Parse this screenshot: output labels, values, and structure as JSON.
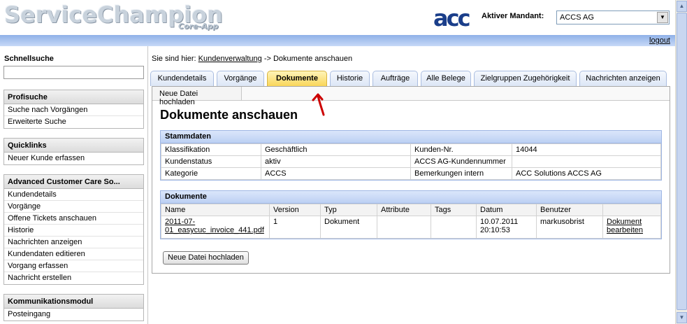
{
  "header": {
    "logo_main": "ServiceChampion",
    "logo_sub": "Core-App",
    "company_logo": "acc",
    "mandant_label": "Aktiver Mandant:",
    "mandant_value": "ACCS AG",
    "logout": "logout"
  },
  "sidebar": {
    "quick_search_title": "Schnellsuche",
    "sections": [
      {
        "title": "Profisuche",
        "items": [
          "Suche nach Vorgängen",
          "Erweiterte Suche"
        ]
      },
      {
        "title": "Quicklinks",
        "items": [
          "Neuer Kunde erfassen"
        ]
      },
      {
        "title": "Advanced Customer Care So...",
        "items": [
          "Kundendetails",
          "Vorgänge",
          "Offene Tickets anschauen",
          "Historie",
          "Nachrichten anzeigen",
          "Kundendaten editieren",
          "Vorgang erfassen",
          "Nachricht erstellen"
        ]
      },
      {
        "title": "Kommunikationsmodul",
        "items": [
          "Posteingang"
        ]
      }
    ]
  },
  "breadcrumb": {
    "prefix": "Sie sind hier:",
    "link": "Kundenverwaltung",
    "rest": "-> Dokumente anschauen"
  },
  "tabs": [
    "Kundendetails",
    "Vorgänge",
    "Dokumente",
    "Historie",
    "Aufträge",
    "Alle Belege",
    "Zielgruppen Zugehörigkeit",
    "Nachrichten anzeigen"
  ],
  "active_tab": "Dokumente",
  "subtab": "Neue Datei hochladen",
  "page_title": "Dokumente anschauen",
  "stammdaten": {
    "title": "Stammdaten",
    "rows": [
      [
        "Klassifikation",
        "Geschäftlich",
        "Kunden-Nr.",
        "14044"
      ],
      [
        "Kundenstatus",
        "aktiv",
        "ACCS AG-Kundennummer",
        ""
      ],
      [
        "Kategorie",
        "ACCS",
        "Bemerkungen intern",
        "ACC Solutions ACCS AG"
      ]
    ]
  },
  "dokumente": {
    "title": "Dokumente",
    "headers": [
      "Name",
      "Version",
      "Typ",
      "Attribute",
      "Tags",
      "Datum",
      "Benutzer",
      ""
    ],
    "row": {
      "name_line1": "2011-07-",
      "name_line2": "01_easycuc_invoice_441.pdf",
      "version": "1",
      "typ": "Dokument",
      "attribute": "",
      "tags": "",
      "datum_line1": "10.07.2011",
      "datum_line2": "20:10:53",
      "benutzer": "markusobrist",
      "action_line1": "Dokument",
      "action_line2": "bearbeiten"
    }
  },
  "upload_button": "Neue Datei hochladen",
  "colors": {
    "accent_tab": "#f9d65a",
    "header_bar": "#8fb1e8",
    "arrow": "#cc0000",
    "acc_logo": "#1a3e8a"
  }
}
